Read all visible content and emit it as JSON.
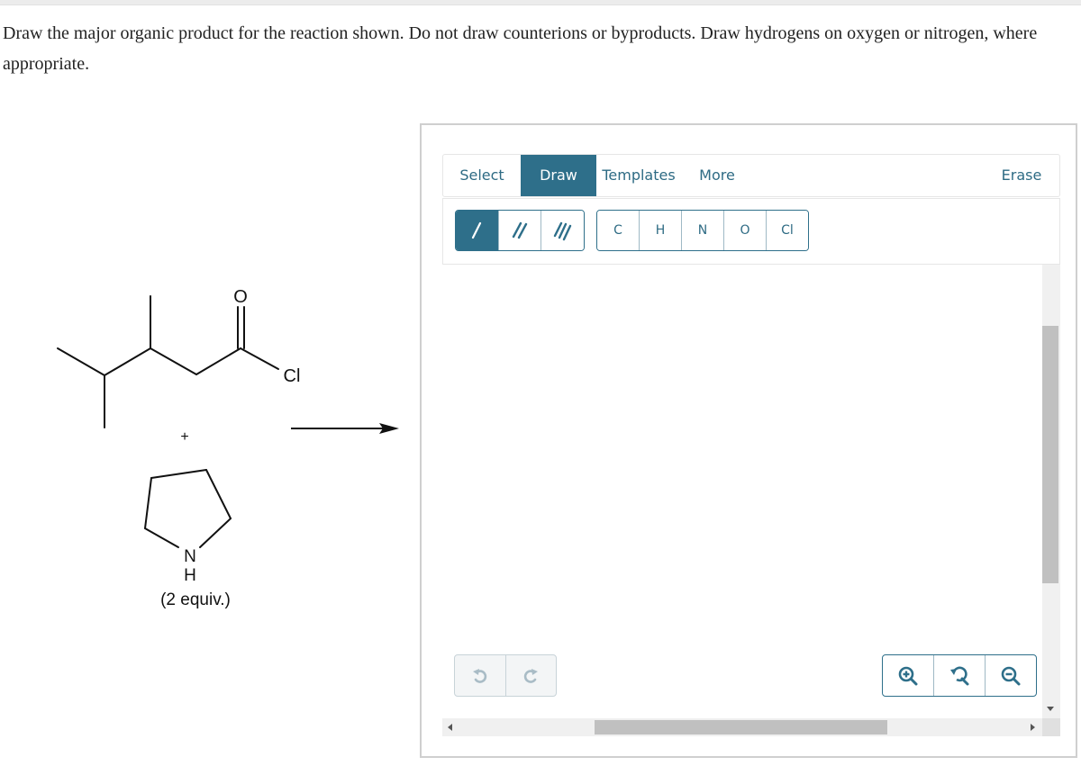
{
  "question": {
    "text": "Draw the major organic product for the reaction shown. Do not draw counterions or byproducts. Draw hydrogens on oxygen or nitrogen, where appropriate."
  },
  "reaction": {
    "reactant1": {
      "name": "3,4-dimethylpentanoyl chloride",
      "atom_labels": {
        "oxygen": "O",
        "chlorine": "Cl"
      }
    },
    "plus_sign": "+",
    "reactant2": {
      "name": "pyrrolidine",
      "atom_labels": {
        "nitrogen": "N",
        "hydrogen": "H"
      },
      "equiv_label": "(2 equiv.)"
    },
    "arrow": "reaction-arrow"
  },
  "editor": {
    "tabs": [
      {
        "label": "Select",
        "active": false
      },
      {
        "label": "Draw",
        "active": true
      },
      {
        "label": "Templates",
        "active": false
      },
      {
        "label": "More",
        "active": false
      }
    ],
    "erase_label": "Erase",
    "bond_tools": [
      {
        "name": "single-bond",
        "active": true
      },
      {
        "name": "double-bond",
        "active": false
      },
      {
        "name": "triple-bond",
        "active": false
      }
    ],
    "atom_tools": [
      "C",
      "H",
      "N",
      "O",
      "Cl"
    ],
    "undo_redo": [
      {
        "name": "undo",
        "enabled": false
      },
      {
        "name": "redo",
        "enabled": false
      }
    ],
    "zoom_controls": [
      {
        "name": "zoom-in"
      },
      {
        "name": "zoom-reset"
      },
      {
        "name": "zoom-out"
      }
    ],
    "colors": {
      "accent": "#2e6f8a",
      "accent_text": "#2e6b84",
      "disabled_icon": "#a9bcc6",
      "scroll_track": "#f0f0f0",
      "scroll_thumb": "#c0c0c0"
    }
  }
}
